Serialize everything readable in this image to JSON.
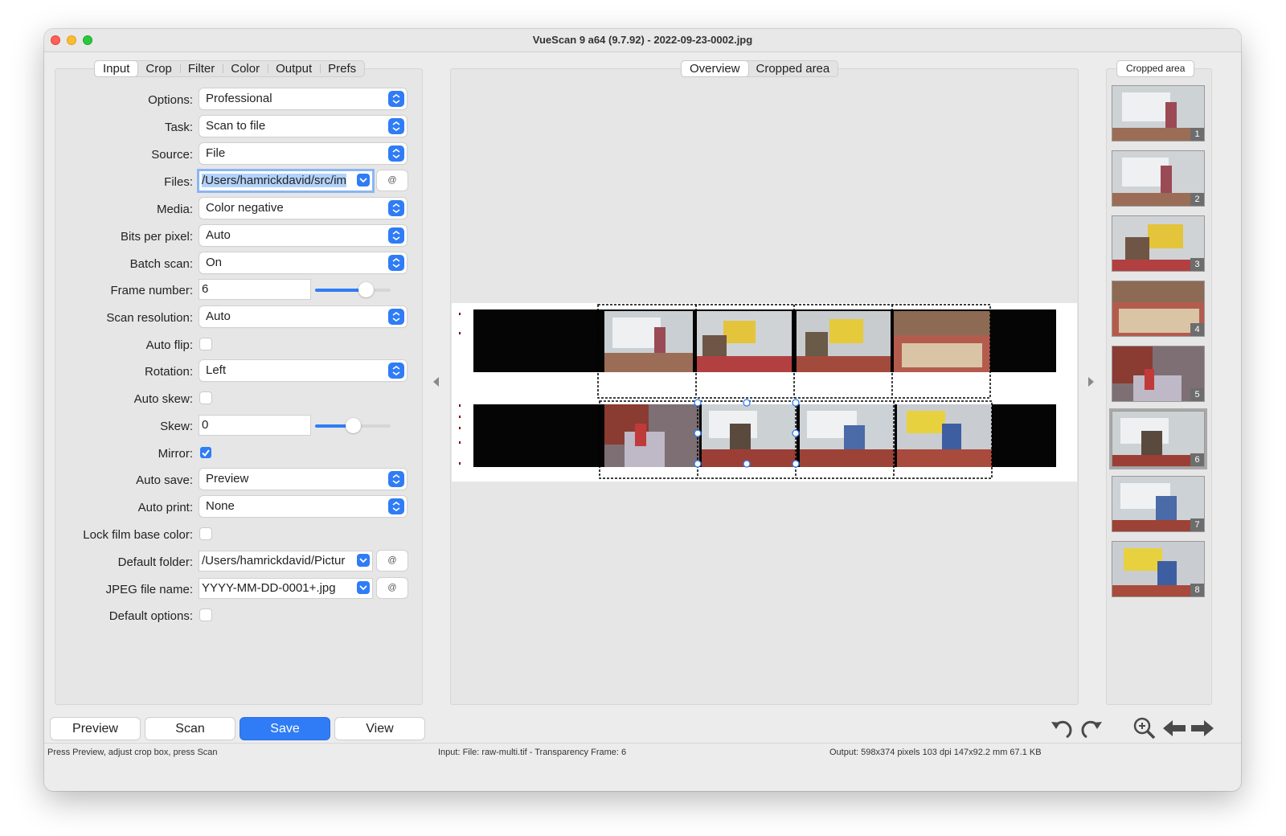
{
  "window": {
    "title": "VueScan 9 a64 (9.7.92) - 2022-09-23-0002.jpg"
  },
  "left_tabs": [
    "Input",
    "Crop",
    "Filter",
    "Color",
    "Output",
    "Prefs"
  ],
  "center_tabs": [
    "Overview",
    "Cropped area"
  ],
  "right_tab": "Cropped area",
  "form": {
    "options_label": "Options:",
    "options_value": "Professional",
    "task_label": "Task:",
    "task_value": "Scan to file",
    "source_label": "Source:",
    "source_value": "File",
    "files_label": "Files:",
    "files_value": "/Users/hamrickdavid/src/im",
    "media_label": "Media:",
    "media_value": "Color negative",
    "bits_label": "Bits per pixel:",
    "bits_value": "Auto",
    "batch_label": "Batch scan:",
    "batch_value": "On",
    "frame_label": "Frame number:",
    "frame_value": "6",
    "frame_slider": 0.67,
    "resolution_label": "Scan resolution:",
    "resolution_value": "Auto",
    "autoflip_label": "Auto flip:",
    "rotation_label": "Rotation:",
    "rotation_value": "Left",
    "autoskew_label": "Auto skew:",
    "skew_label": "Skew:",
    "skew_value": "0",
    "skew_slider": 0.5,
    "mirror_label": "Mirror:",
    "autosave_label": "Auto save:",
    "autosave_value": "Preview",
    "autoprint_label": "Auto print:",
    "autoprint_value": "None",
    "lockfilm_label": "Lock film base color:",
    "folder_label": "Default folder:",
    "folder_value": "/Users/hamrickdavid/Pictur",
    "jpeg_label": "JPEG file name:",
    "jpeg_value": "YYYY-MM-DD-0001+.jpg",
    "defaultopts_label": "Default options:",
    "at_label": "@"
  },
  "buttons": {
    "preview": "Preview",
    "scan": "Scan",
    "save": "Save",
    "view": "View"
  },
  "thumbnails": [
    "1",
    "2",
    "3",
    "4",
    "5",
    "6",
    "7",
    "8"
  ],
  "status": {
    "left": "Press Preview, adjust crop box, press Scan",
    "middle": "Input: File: raw-multi.tif - Transparency Frame: 6",
    "right": "Output: 598x374 pixels 103 dpi 147x92.2 mm 67.1 KB"
  },
  "colors": {
    "accent": "#2f7cf6"
  },
  "icons": [
    "undo-icon",
    "redo-icon",
    "zoom-in-icon",
    "arrow-left-icon",
    "arrow-right-icon",
    "chevron-left-icon",
    "chevron-right-icon"
  ]
}
